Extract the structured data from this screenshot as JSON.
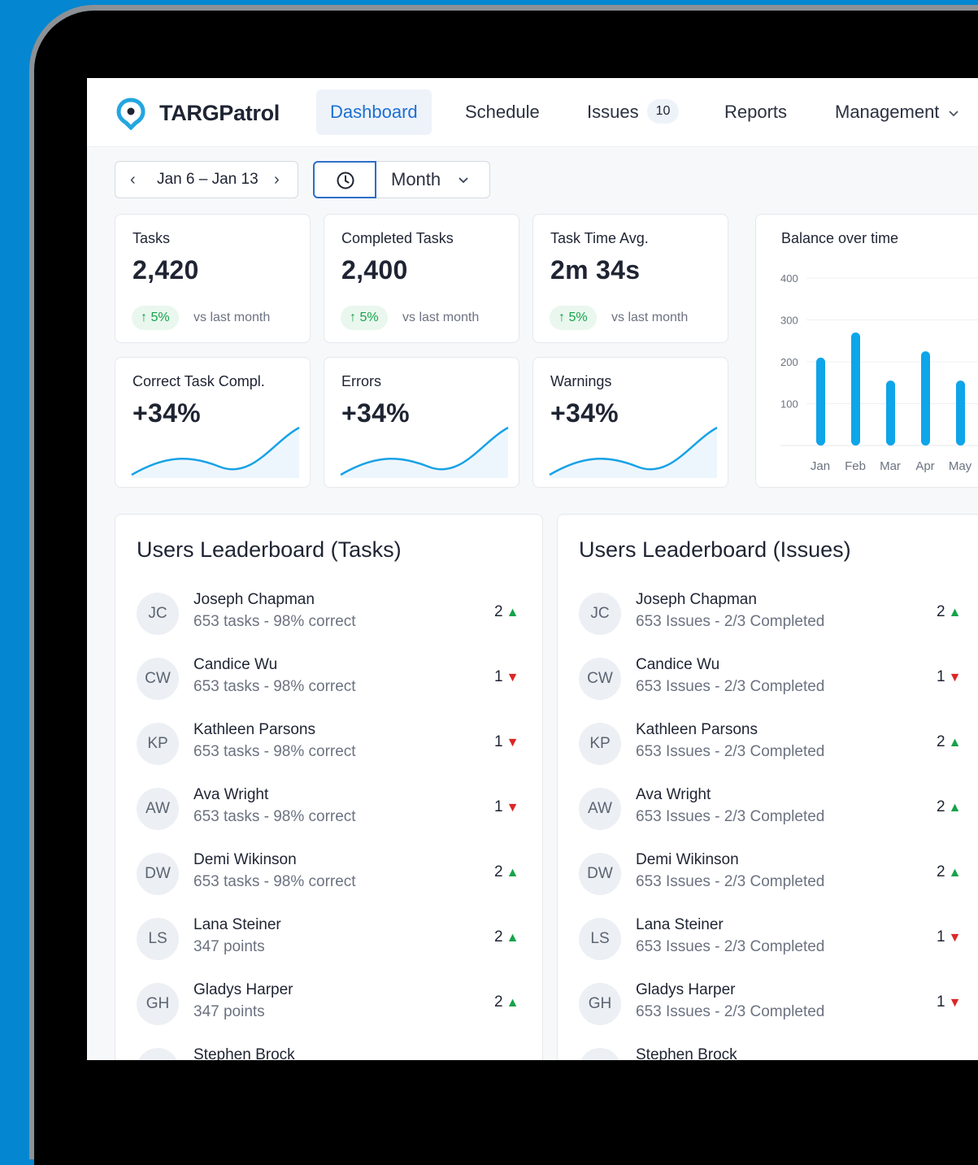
{
  "app": {
    "brand": "TARGPatrol"
  },
  "nav": {
    "dashboard": "Dashboard",
    "schedule": "Schedule",
    "issues": "Issues",
    "issues_badge": "10",
    "reports": "Reports",
    "management": "Management"
  },
  "toolbar": {
    "date_range": "Jan 6 – Jan 13",
    "prev_glyph": "‹",
    "next_glyph": "›",
    "period": "Month"
  },
  "stats": [
    {
      "label": "Tasks",
      "value": "2,420",
      "delta": "↑ 5%",
      "compare": "vs last month"
    },
    {
      "label": "Completed Tasks",
      "value": "2,400",
      "delta": "↑ 5%",
      "compare": "vs last month"
    },
    {
      "label": "Task Time Avg.",
      "value": "2m 34s",
      "delta": "↑ 5%",
      "compare": "vs last month"
    }
  ],
  "trends": [
    {
      "label": "Correct Task Compl.",
      "value": "+34%"
    },
    {
      "label": "Errors",
      "value": "+34%"
    },
    {
      "label": "Warnings",
      "value": "+34%"
    }
  ],
  "colors": {
    "accent": "#1c6fd2",
    "bar": "#0ea5e9",
    "up": "#16a34a",
    "down": "#dc2626"
  },
  "chart_data": {
    "type": "bar",
    "title": "Balance over time",
    "categories": [
      "Jan",
      "Feb",
      "Mar",
      "Apr",
      "May"
    ],
    "values": [
      210,
      270,
      155,
      225,
      155
    ],
    "yticks": [
      100,
      200,
      300,
      400
    ],
    "ylim": [
      0,
      400
    ],
    "grid": true
  },
  "leaderboard_tasks": {
    "title": "Users Leaderboard (Tasks)",
    "rows": [
      {
        "initials": "JC",
        "name": "Joseph Chapman",
        "sub": "653 tasks - 98% correct",
        "rank": "2",
        "trend": "up"
      },
      {
        "initials": "CW",
        "name": "Candice Wu",
        "sub": "653 tasks - 98% correct",
        "rank": "1",
        "trend": "down"
      },
      {
        "initials": "KP",
        "name": "Kathleen Parsons",
        "sub": "653 tasks - 98% correct",
        "rank": "1",
        "trend": "down"
      },
      {
        "initials": "AW",
        "name": "Ava Wright",
        "sub": "653 tasks - 98% correct",
        "rank": "1",
        "trend": "down"
      },
      {
        "initials": "DW",
        "name": "Demi Wikinson",
        "sub": "653 tasks - 98% correct",
        "rank": "2",
        "trend": "up"
      },
      {
        "initials": "LS",
        "name": "Lana Steiner",
        "sub": "347 points",
        "rank": "2",
        "trend": "up"
      },
      {
        "initials": "GH",
        "name": "Gladys Harper",
        "sub": "347 points",
        "rank": "2",
        "trend": "up"
      },
      {
        "initials": "",
        "name": "Stephen Brock",
        "sub": "",
        "rank": "",
        "trend": ""
      }
    ]
  },
  "leaderboard_issues": {
    "title": "Users Leaderboard (Issues)",
    "rows": [
      {
        "initials": "JC",
        "name": "Joseph Chapman",
        "sub": "653 Issues - 2/3 Completed",
        "rank": "2",
        "trend": "up"
      },
      {
        "initials": "CW",
        "name": "Candice Wu",
        "sub": "653 Issues - 2/3 Completed",
        "rank": "1",
        "trend": "down"
      },
      {
        "initials": "KP",
        "name": "Kathleen Parsons",
        "sub": "653 Issues - 2/3 Completed",
        "rank": "2",
        "trend": "up"
      },
      {
        "initials": "AW",
        "name": "Ava Wright",
        "sub": "653 Issues - 2/3 Completed",
        "rank": "2",
        "trend": "up"
      },
      {
        "initials": "DW",
        "name": "Demi Wikinson",
        "sub": "653 Issues - 2/3 Completed",
        "rank": "2",
        "trend": "up"
      },
      {
        "initials": "LS",
        "name": "Lana Steiner",
        "sub": "653 Issues - 2/3 Completed",
        "rank": "1",
        "trend": "down"
      },
      {
        "initials": "GH",
        "name": "Gladys Harper",
        "sub": "653 Issues - 2/3 Completed",
        "rank": "1",
        "trend": "down"
      },
      {
        "initials": "",
        "name": "Stephen Brock",
        "sub": "",
        "rank": "",
        "trend": ""
      }
    ]
  }
}
